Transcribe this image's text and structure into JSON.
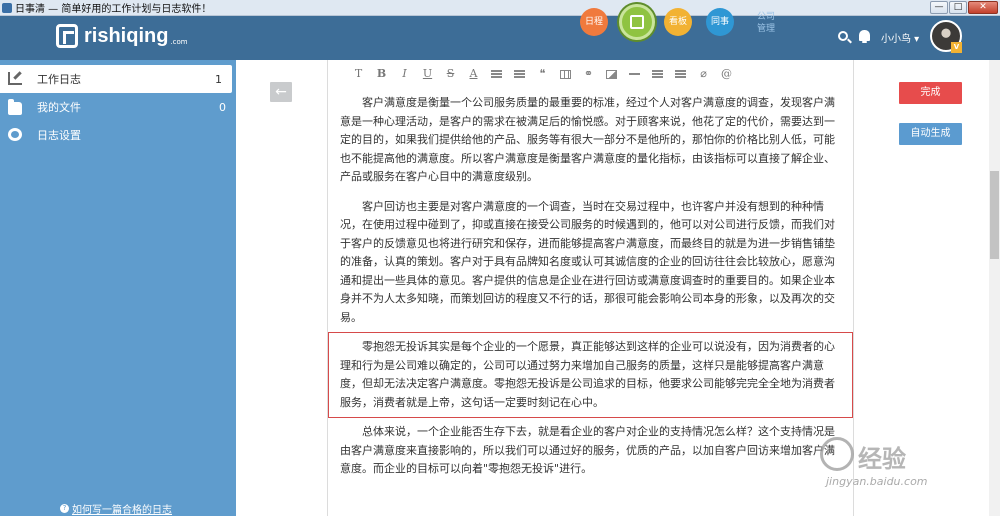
{
  "window": {
    "title": "日事清 — 简单好用的工作计划与日志软件！",
    "controls": [
      "—",
      "□",
      "✕"
    ]
  },
  "header": {
    "logo_text": "rishiqing",
    "logo_sub": ".com",
    "nav": {
      "riji": "日程",
      "kanban": "看板",
      "tongshi": "同事",
      "company": "公司管理"
    },
    "username": "小小鸟 ▾",
    "vip": "V"
  },
  "sidebar": {
    "items": [
      {
        "label": "工作日志",
        "count": "1"
      },
      {
        "label": "我的文件",
        "count": "0"
      },
      {
        "label": "日志设置",
        "count": ""
      }
    ],
    "help": "如何写一篇合格的日志",
    "help_icon": "?"
  },
  "main": {
    "back": "←",
    "toolbar": [
      "T",
      "B",
      "I",
      "U",
      "S",
      "A",
      "",
      "",
      "❝",
      "",
      "⚭",
      "",
      "",
      "",
      "",
      "",
      "@"
    ],
    "paragraphs": [
      "客户满意度是衡量一个公司服务质量的最重要的标准，经过个人对客户满意度的调查，发现客户满意是一种心理活动，是客户的需求在被满足后的愉悦感。对于顾客来说，他花了定的代价，需要达到一定的目的，如果我们提供给他的产品、服务等有很大一部分不是他所的，那怕你的价格比别人低，可能也不能提高他的满意度。所以客户满意度是衡量客户满意度的量化指标，由该指标可以直接了解企业、产品或服务在客户心目中的满意度级别。",
      "客户回访也主要是对客户满意度的一个调查，当时在交易过程中，也许客户并没有想到的种种情况，在使用过程中碰到了，抑或直接在接受公司服务的时候遇到的，他可以对公司进行反馈，而我们对于客户的反馈意见也将进行研究和保存，进而能够提高客户满意度，而最终目的就是为进一步销售铺垫的准备，认真的策划。客户对于具有品牌知名度或认可其诚信度的企业的回访往往会比较放心，愿意沟通和提出一些具体的意见。客户提供的信息是企业在进行回访或满意度调查时的重要目的。如果企业本身并不为人太多知晓，而策划回访的程度又不行的话，那很可能会影响公司本身的形象，以及再次的交易。",
      "零抱怨无投诉其实是每个企业的一个愿景，真正能够达到这样的企业可以说没有，因为消费者的心理和行为是公司难以确定的，公司可以通过努力来增加自己服务的质量，这样只是能够提高客户满意度，但却无法决定客户满意度。零抱怨无投诉是公司追求的目标，他要求公司能够完完全全地为消费者服务，消费者就是上帝，这句话一定要时刻记在心中。",
      "总体来说，一个企业能否生存下去，就是看企业的客户对企业的支持情况怎么样？这个支持情况是由客户满意度来直接影响的，所以我们可以通过好的服务，优质的产品，以加自客户回访来增加客户满意度。而企业的目标可以向着\"零抱怨无投诉\"进行。"
    ],
    "finish": "完成",
    "auto_generate": "自动生成"
  },
  "watermark": {
    "text": "经验",
    "sub": "jingyan.baidu.com"
  }
}
